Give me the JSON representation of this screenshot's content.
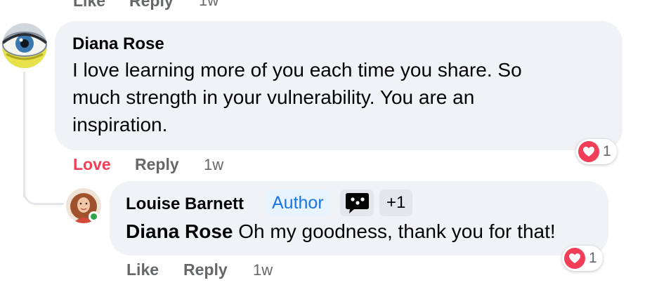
{
  "top_actions": {
    "like": "Like",
    "reply": "Reply",
    "time": "1w"
  },
  "comments": [
    {
      "author": "Diana Rose",
      "text_lines": [
        "I love learning more of you each time you share. So",
        "much strength in your vulnerability. You are an",
        "inspiration."
      ],
      "reaction": {
        "icon": "heart-icon",
        "count": "1"
      },
      "actions": {
        "like": "Love",
        "reply": "Reply",
        "time": "1w"
      }
    },
    {
      "author": "Louise Barnett",
      "author_badge": "Author",
      "extra_badge_icon": "speech-bubble-icon",
      "extra_badge_count": "+1",
      "mention": "Diana Rose",
      "text": " Oh my goodness, thank you for that!",
      "online": true,
      "reaction": {
        "icon": "heart-icon",
        "count": "1"
      },
      "actions": {
        "like": "Like",
        "reply": "Reply",
        "time": "1w"
      }
    }
  ],
  "colors": {
    "bubble": "#f0f2f5",
    "love": "#f33e58",
    "author_badge_text": "#1b74e4",
    "author_badge_bg": "#e7f3ff",
    "secondary_text": "#65676b",
    "online": "#31a24c"
  }
}
